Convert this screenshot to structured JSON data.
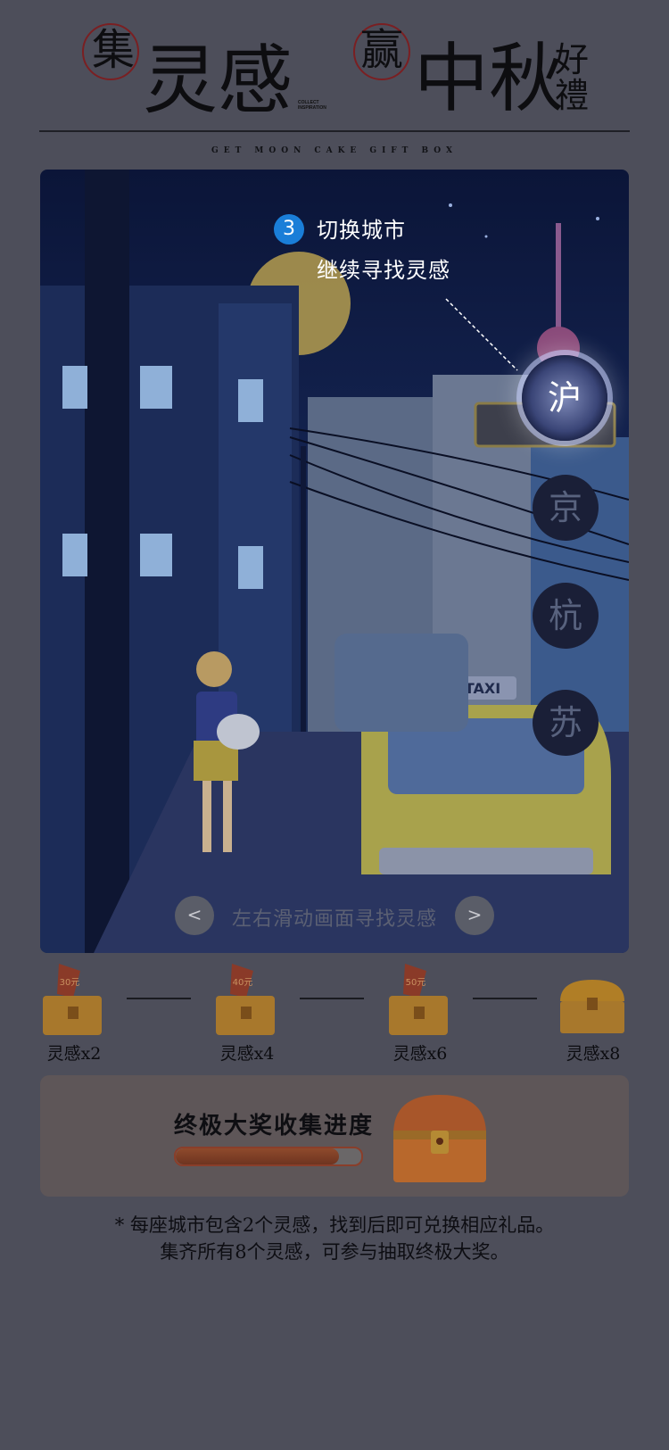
{
  "header": {
    "circle_char_1": "集",
    "big_text_1": "灵感",
    "english_small": "COLLECT INSPIRATION",
    "circle_char_2": "赢",
    "big_text_2": "中秋",
    "side_top": "好",
    "side_bottom": "禮",
    "subtitle": "GET MOON CAKE GIFT BOX"
  },
  "scene": {
    "step_number": "3",
    "step_title": "切换城市",
    "step_subtitle": "继续寻找灵感",
    "taxi_sign": "TAXI",
    "cities": [
      {
        "label": "沪",
        "active": true
      },
      {
        "label": "京",
        "active": false
      },
      {
        "label": "杭",
        "active": false
      },
      {
        "label": "苏",
        "active": false
      }
    ],
    "prev_label": "<",
    "next_label": ">",
    "swipe_hint": "左右滑动画面寻找灵感"
  },
  "milestones": [
    {
      "label": "灵感x2",
      "flag": "30元"
    },
    {
      "label": "灵感x4",
      "flag": "40元"
    },
    {
      "label": "灵感x6",
      "flag": "50元"
    },
    {
      "label": "灵感x8",
      "flag": ""
    }
  ],
  "prize": {
    "title": "终极大奖收集进度",
    "progress": 0.88
  },
  "footnote": {
    "line1": "* 每座城市包含2个灵感，找到后即可兑换相应礼品。",
    "line2": "集齐所有8个灵感，可参与抽取终极大奖。"
  },
  "colors": {
    "background": "#4d4e5a",
    "accent_blue": "#1a7ed8",
    "chest_orange": "#c8781e"
  }
}
